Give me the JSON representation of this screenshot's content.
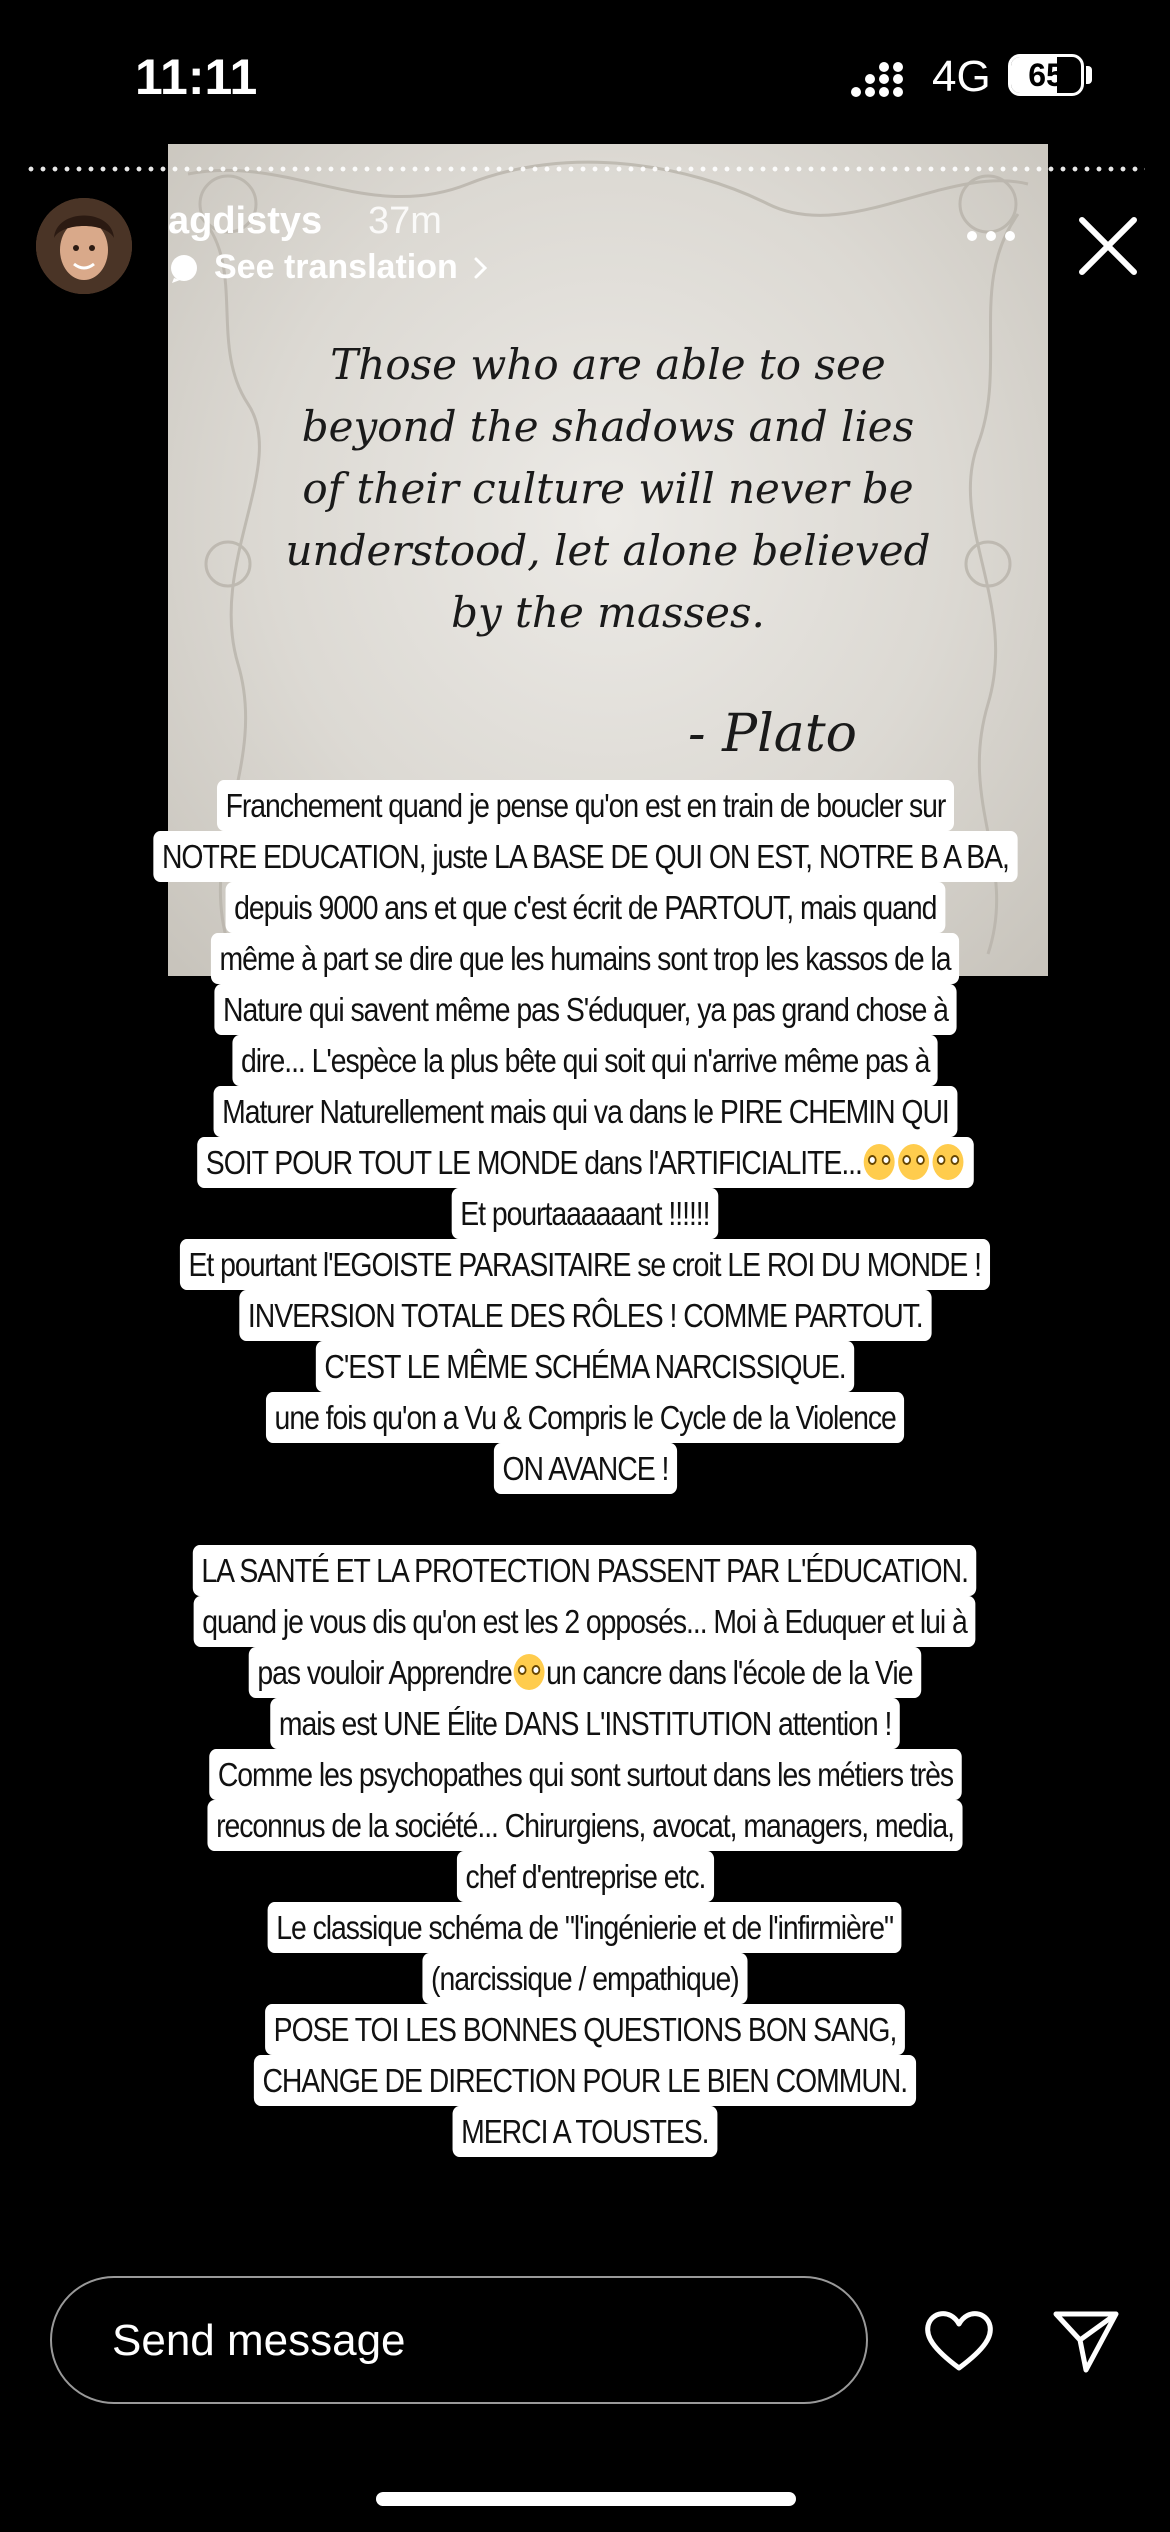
{
  "status_bar": {
    "time": "11:11",
    "network": "4G",
    "battery": "65",
    "battery_level": 0.65
  },
  "story": {
    "username": "agdistys",
    "time_ago": "37m",
    "translation": "See translation",
    "photo": {
      "quote": "Those who are able to see\nbeyond the shadows and lies\nof their culture will never be\nunderstood, let alone believed\nby the masses.",
      "author": "- Plato"
    },
    "text_lines": [
      "Franchement quand je pense qu'on est en train de boucler sur",
      "NOTRE EDUCATION, juste LA BASE DE QUI ON EST, NOTRE B A BA,",
      "depuis 9000 ans et que c'est écrit de PARTOUT, mais quand",
      "même à part se dire que les humains sont trop les kassos de la",
      "Nature qui savent même pas S'éduquer, ya pas grand chose à",
      "dire... L'espèce la plus bête qui soit qui n'arrive même pas à",
      "Maturer Naturellement mais qui va dans le PIRE CHEMIN QUI",
      "SOIT POUR TOUT LE MONDE dans l'ARTIFICIALITE...",
      "Et pourtaaaaaant !!!!!!",
      "Et pourtant l'EGOISTE PARASITAIRE se croit LE ROI DU MONDE !",
      "INVERSION TOTALE DES RÔLES ! COMME PARTOUT.",
      "C'EST LE MÊME SCHÉMA NARCISSIQUE.",
      "une fois qu'on a Vu & Compris le Cycle de la Violence",
      "ON AVANCE !",
      "",
      "LA SANTÉ ET LA PROTECTION PASSENT PAR L'ÉDUCATION.",
      "quand je vous dis qu'on est les 2 opposés... Moi à Eduquer et lui à",
      "pas vouloir Apprendre",
      "un cancre dans l'école de la Vie",
      "mais est UNE Élite DANS L'INSTITUTION attention !",
      "Comme les psychopathes qui sont surtout dans les métiers très",
      "reconnus de la société... Chirurgiens, avocat, managers, media,",
      "chef d'entreprise etc.",
      "Le classique schéma de \"l'ingénierie et de l'infirmière\"",
      "(narcissique / empathique)",
      "POSE TOI LES BONNES QUESTIONS BON SANG,",
      "CHANGE DE DIRECTION POUR LE BIEN COMMUN.",
      "MERCI A TOUSTES."
    ]
  },
  "footer": {
    "message_placeholder": "Send message"
  },
  "icons": [
    "signal-icon",
    "more-icon",
    "close-icon",
    "chevron-right-icon",
    "translate-bubble-icon",
    "heart-icon",
    "send-icon",
    "eye-roll-emoji"
  ]
}
